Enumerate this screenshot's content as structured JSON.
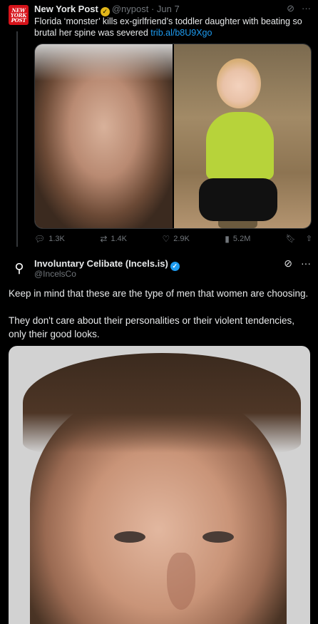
{
  "tweet1": {
    "avatar_text": "NEW YORK POST",
    "name": "New York Post",
    "handle_date": "@nypost · Jun 7",
    "text": "Florida ‘monster’ kills ex-girlfriend’s toddler daughter with beating so brutal her spine was severed",
    "link": "trib.al/b8U9Xgo",
    "stats": {
      "replies": "1.3K",
      "reposts": "1.4K",
      "likes": "2.9K",
      "views": "5.2M"
    }
  },
  "tweet2": {
    "name": "Involuntary Celibate (Incels.is)",
    "handle": "@IncelsCo",
    "paragraph1": "Keep in mind that these are the type of men that women are choosing.",
    "paragraph2": "They don't care about their personalities or their violent tendencies, only their good looks."
  },
  "colors": {
    "background": "#000000",
    "link": "#1d9bf0",
    "muted": "#71767b",
    "verified_gold": "#e2b719",
    "verified_blue": "#1d9bf0",
    "nyp_red": "#d6131a"
  },
  "icons": {
    "reply": "reply-icon",
    "repost": "repost-icon",
    "like": "heart-icon",
    "views": "views-icon",
    "bookmark": "bookmark-icon",
    "share": "share-icon",
    "grok": "grok-icon",
    "more": "more-icon"
  }
}
